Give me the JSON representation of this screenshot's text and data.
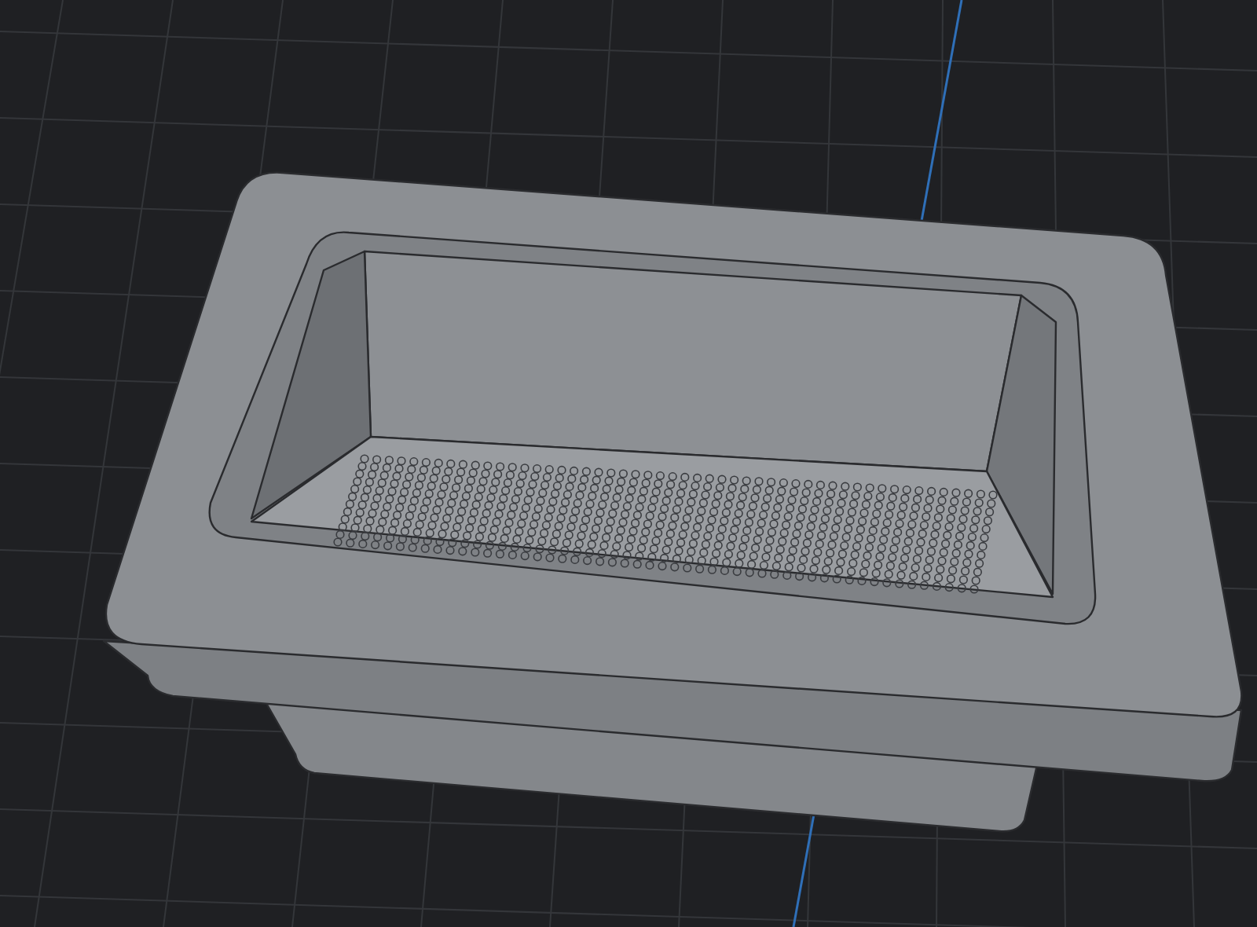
{
  "viewport": {
    "kind": "model-view"
  }
}
